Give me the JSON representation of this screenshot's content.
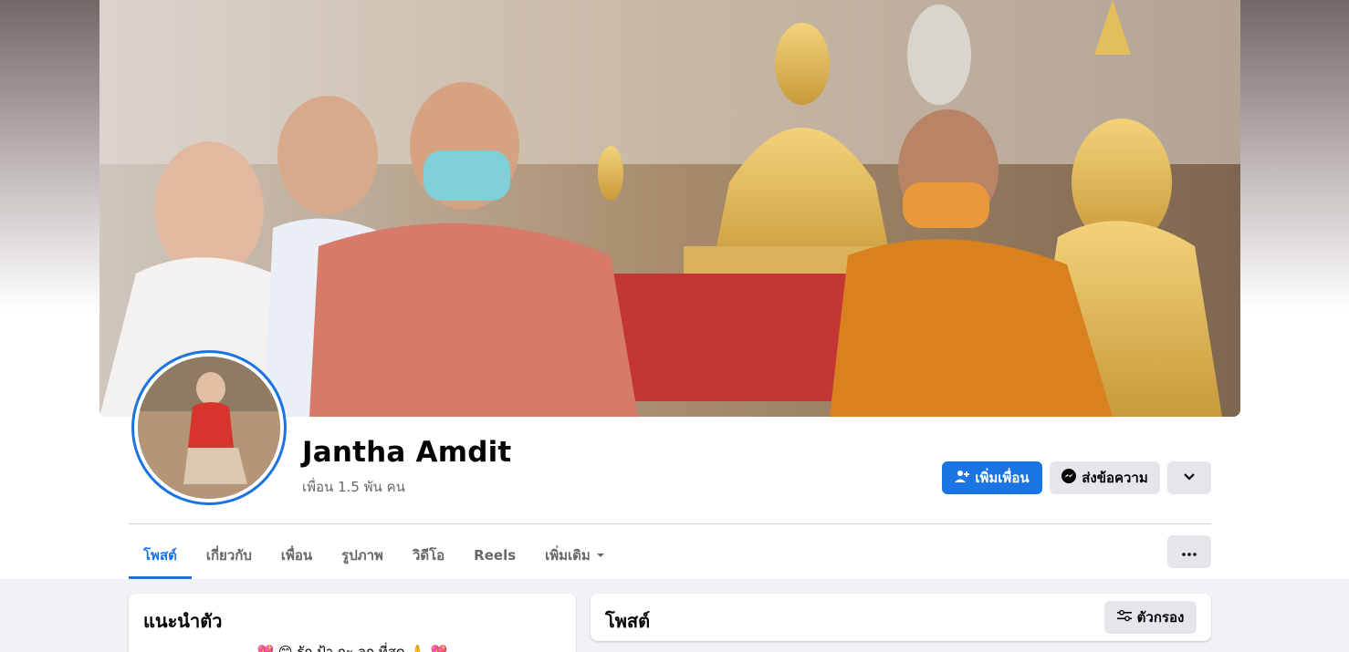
{
  "profile": {
    "name": "Jantha Amdit",
    "friends_text": "เพื่อน 1.5 พัน คน"
  },
  "actions": {
    "add_friend_label": "เพิ่มเพื่อน",
    "message_label": "ส่งข้อความ"
  },
  "tabs": [
    {
      "label": "โพสต์",
      "active": true
    },
    {
      "label": "เกี่ยวกับ"
    },
    {
      "label": "เพื่อน"
    },
    {
      "label": "รูปภาพ"
    },
    {
      "label": "วิดีโอ"
    },
    {
      "label": "Reels"
    },
    {
      "label": "เพิ่มเติม"
    }
  ],
  "intro": {
    "title": "แนะนำตัว",
    "bio": "💖 😊 รัก ป้า กะ ลุก ที่สุด 🙏 💖"
  },
  "posts": {
    "title": "โพสต์",
    "filter_label": "ตัวกรอง"
  },
  "colors": {
    "accent": "#1b74e4",
    "secondary_button": "#e4e6eb",
    "page_bg": "#f0f2f5"
  },
  "icons": {
    "add_friend": "add-person-icon",
    "message": "messenger-icon",
    "dropdown": "chevron-down-icon",
    "more": "more-dots-icon",
    "filter": "filter-sliders-icon"
  }
}
